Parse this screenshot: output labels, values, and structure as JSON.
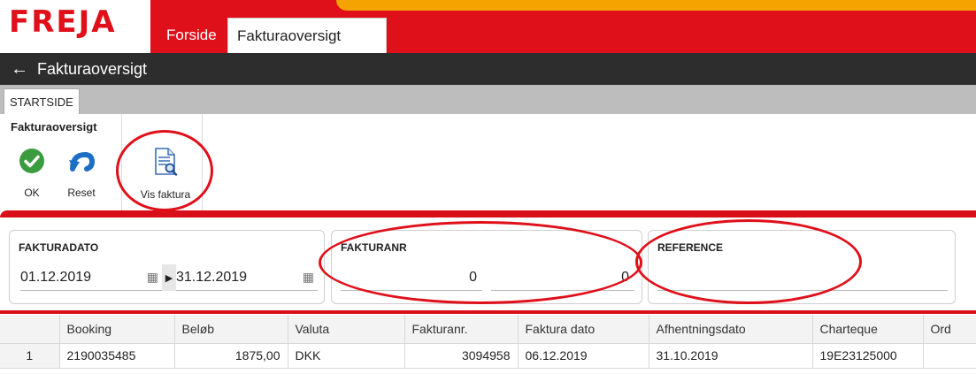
{
  "brand": {
    "logo": "FREJA",
    "red": "#e0101a",
    "orange": "#f4a300",
    "dark": "#2d2d2d"
  },
  "tabs": [
    {
      "label": "Forside",
      "active": false
    },
    {
      "label": "Fakturaoversigt",
      "active": true
    }
  ],
  "page": {
    "title": "Fakturaoversigt",
    "back_icon": "arrow-left-icon"
  },
  "ribbon": {
    "tab": "STARTSIDE",
    "group_title": "Fakturaoversigt",
    "buttons": {
      "ok": {
        "label": "OK",
        "icon": "checkmark-circle-icon"
      },
      "reset": {
        "label": "Reset",
        "icon": "undo-icon"
      },
      "vis": {
        "label": "Vis faktura",
        "icon": "document-search-icon"
      }
    }
  },
  "filters": {
    "fakturadato": {
      "title": "FAKTURADATO",
      "from": "01.12.2019",
      "to": "31.12.2019",
      "calendar_icon": "calendar-icon",
      "range_icon": "triangle-right-icon"
    },
    "fakturanr": {
      "title": "FAKTURANR",
      "from": "0",
      "to": "0"
    },
    "reference": {
      "title": "REFERENCE",
      "value": ""
    }
  },
  "grid": {
    "columns": [
      "",
      "Booking",
      "Beløb",
      "Valuta",
      "Fakturanr.",
      "Faktura dato",
      "Afhentningsdato",
      "Charteque",
      "Ord"
    ],
    "rows": [
      [
        "1",
        "2190035485",
        "1875,00",
        "DKK",
        "3094958",
        "06.12.2019",
        "31.10.2019",
        "19E23125000",
        ""
      ]
    ]
  }
}
